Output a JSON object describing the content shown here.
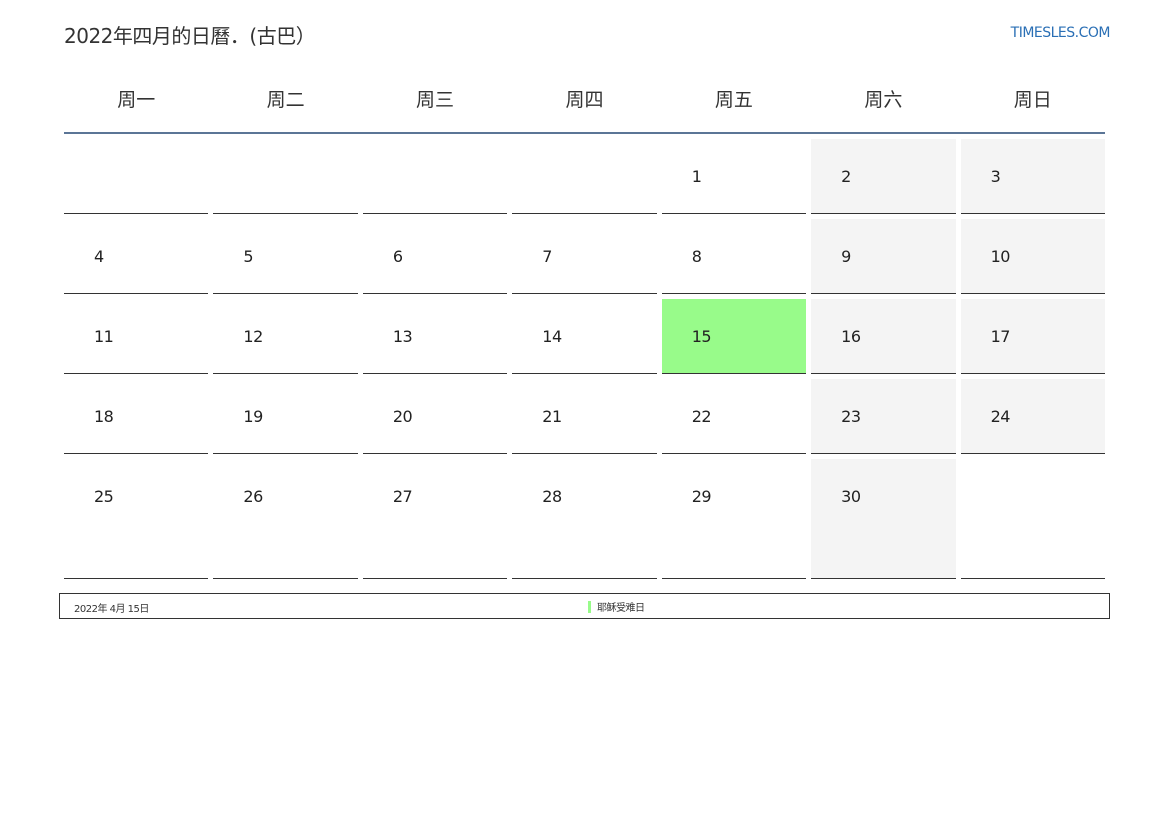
{
  "header": {
    "title": "2022年四月的日曆．(古巴）",
    "site": "TIMESLES.COM"
  },
  "weekdays": [
    "周一",
    "周二",
    "周三",
    "周四",
    "周五",
    "周六",
    "周日"
  ],
  "colors": {
    "holiday": "#98fb8a",
    "weekend": "#f4f4f4",
    "header_rule": "#5b7596",
    "link": "#2a6fb5"
  },
  "weeks": [
    [
      "",
      "",
      "",
      "",
      "1",
      "2",
      "3"
    ],
    [
      "4",
      "5",
      "6",
      "7",
      "8",
      "9",
      "10"
    ],
    [
      "11",
      "12",
      "13",
      "14",
      "15",
      "16",
      "17"
    ],
    [
      "18",
      "19",
      "20",
      "21",
      "22",
      "23",
      "24"
    ],
    [
      "25",
      "26",
      "27",
      "28",
      "29",
      "30",
      ""
    ]
  ],
  "holidays": [
    "15"
  ],
  "legend": {
    "date": "2022年 4月 15日",
    "event": "耶稣受难日"
  }
}
